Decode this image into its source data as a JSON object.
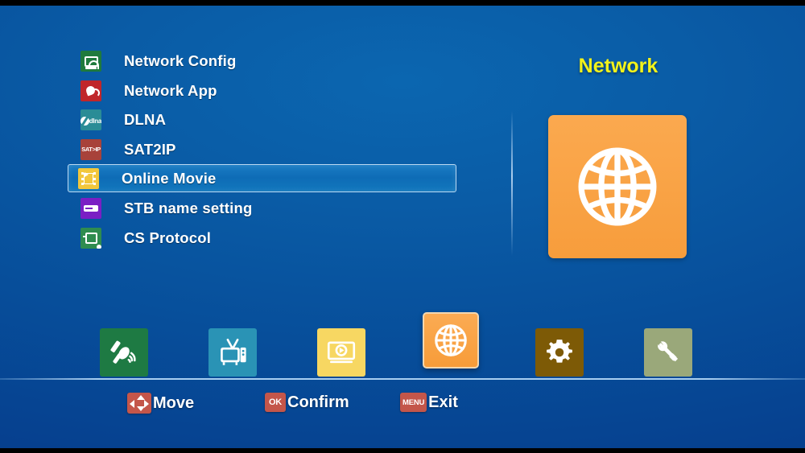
{
  "screen": {
    "background_color": "#0a5ca6",
    "top_letterbox_color": "#000000"
  },
  "menu": {
    "selected_index": 4,
    "items": [
      {
        "label": "Network Config",
        "icon": "network-config-icon",
        "icon_color": "#1f7a3d"
      },
      {
        "label": "Network App",
        "icon": "network-app-icon",
        "icon_color": "#c0262a"
      },
      {
        "label": "DLNA",
        "icon": "dlna-icon",
        "icon_color": "#2a8c96",
        "icon_text": "dlna"
      },
      {
        "label": "SAT2IP",
        "icon": "sat2ip-icon",
        "icon_color": "#a8423a",
        "icon_text": "SAT>IP"
      },
      {
        "label": "Online Movie",
        "icon": "online-movie-icon",
        "icon_color": "#f2c73c"
      },
      {
        "label": "STB name setting",
        "icon": "stb-name-icon",
        "icon_color": "#7a1fc4"
      },
      {
        "label": "CS Protocol",
        "icon": "cs-protocol-icon",
        "icon_color": "#2f8c4f"
      }
    ]
  },
  "panel": {
    "title": "Network",
    "title_color": "#f2f21a",
    "icon": "globe-icon",
    "tile_color": "#f79d3c"
  },
  "category_bar": {
    "selected": "network",
    "tiles": [
      {
        "name": "satellite",
        "icon": "satellite-dish-icon",
        "color": "#1e7a43"
      },
      {
        "name": "tv",
        "icon": "television-icon",
        "color": "#2a93b5"
      },
      {
        "name": "media",
        "icon": "media-player-icon",
        "color": "#f7d762"
      },
      {
        "name": "network",
        "icon": "globe-icon",
        "color": "#f79d3c"
      },
      {
        "name": "settings",
        "icon": "gear-icon",
        "color": "#7d5a06"
      },
      {
        "name": "tools",
        "icon": "tools-icon",
        "color": "#9aa87a"
      }
    ]
  },
  "footer": {
    "badge_color": "#c4564a",
    "hints": [
      {
        "key": "",
        "icon": "dpad-icon",
        "label": "Move"
      },
      {
        "key": "OK",
        "icon": "",
        "label": "Confirm"
      },
      {
        "key": "MENU",
        "icon": "",
        "label": "Exit"
      }
    ]
  }
}
